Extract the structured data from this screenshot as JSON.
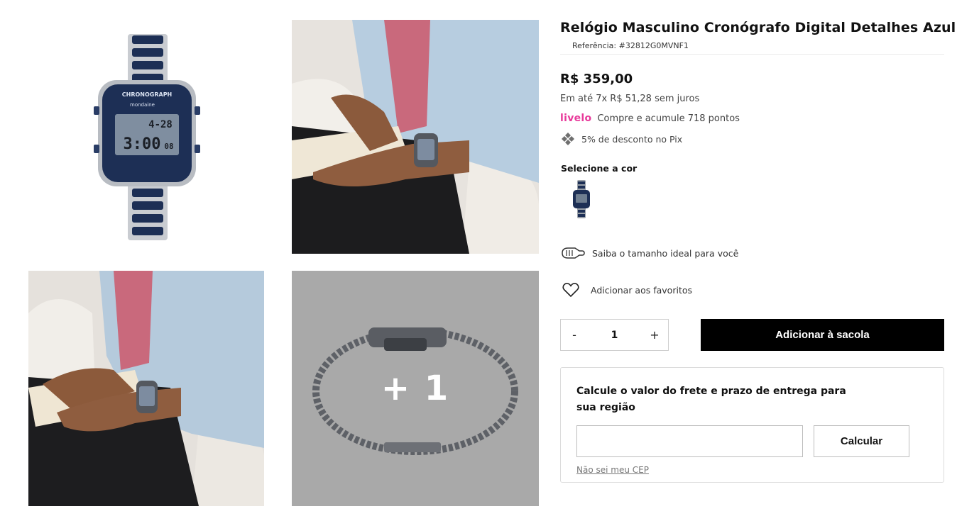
{
  "product": {
    "title": "Relógio Masculino Cronógrafo Digital Detalhes Azul",
    "reference": "Referência: #32812G0MVNF1",
    "price": "R$ 359,00",
    "installments": "Em até 7x R$ 51,28 sem juros",
    "livelo_logo": "livelo",
    "livelo_text": "Compre e acumule 718 pontos",
    "pix_text": "5% de desconto no Pix"
  },
  "watch_face": {
    "brand": "mondaine",
    "bezel_text": "CHRONOGRAPH",
    "time_top": "4-28",
    "time_main": "3:00",
    "seconds": "08"
  },
  "gallery": {
    "more_label": "+ 1"
  },
  "color": {
    "label": "Selecione a cor"
  },
  "links": {
    "size_guide": "Saiba o tamanho ideal para você",
    "favorites": "Adicionar aos favoritos"
  },
  "cart": {
    "minus": "-",
    "quantity": "1",
    "plus": "+",
    "add_label": "Adicionar à sacola"
  },
  "shipping": {
    "title": "Calcule o valor do frete e prazo de entrega para sua região",
    "input_placeholder": "",
    "button": "Calcular",
    "no_cep": "Não sei meu CEP"
  },
  "colors": {
    "accent_pink": "#e8399a",
    "button_bg": "#000000",
    "watch_blue": "#1d2f55"
  }
}
